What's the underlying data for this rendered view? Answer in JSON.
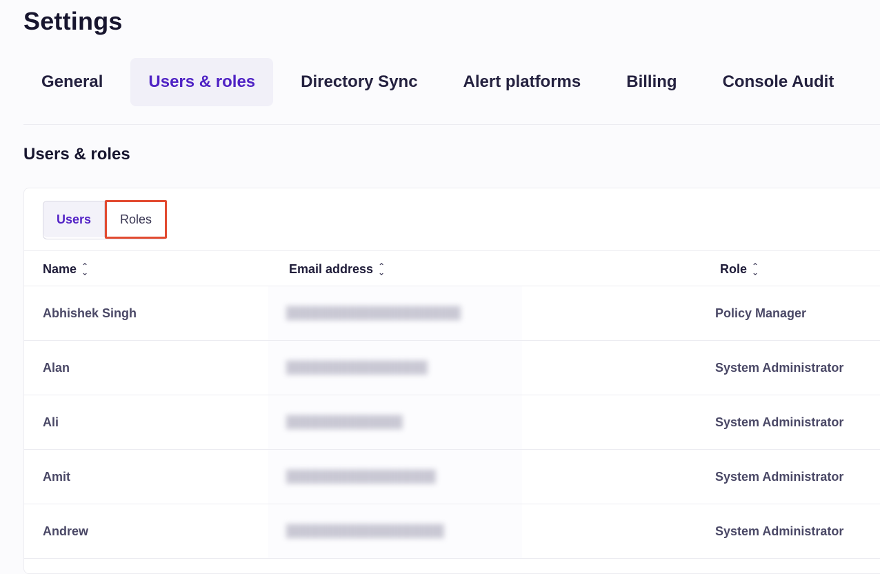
{
  "page": {
    "title": "Settings"
  },
  "tabs": [
    {
      "label": "General",
      "active": false
    },
    {
      "label": "Users & roles",
      "active": true
    },
    {
      "label": "Directory Sync",
      "active": false
    },
    {
      "label": "Alert platforms",
      "active": false
    },
    {
      "label": "Billing",
      "active": false
    },
    {
      "label": "Console Audit",
      "active": false
    }
  ],
  "section": {
    "title": "Users & roles"
  },
  "toggle": {
    "users_label": "Users",
    "roles_label": "Roles",
    "selected": "Users"
  },
  "table": {
    "columns": [
      "Name",
      "Email address",
      "Role"
    ],
    "rows": [
      {
        "name": "Abhishek Singh",
        "role": "Policy Manager"
      },
      {
        "name": "Alan",
        "role": "System Administrator"
      },
      {
        "name": "Ali",
        "role": "System Administrator"
      },
      {
        "name": "Amit",
        "role": "System Administrator"
      },
      {
        "name": "Andrew",
        "role": "System Administrator"
      }
    ]
  },
  "colors": {
    "accent": "#4f22c4",
    "highlight_box": "#e24a30"
  }
}
